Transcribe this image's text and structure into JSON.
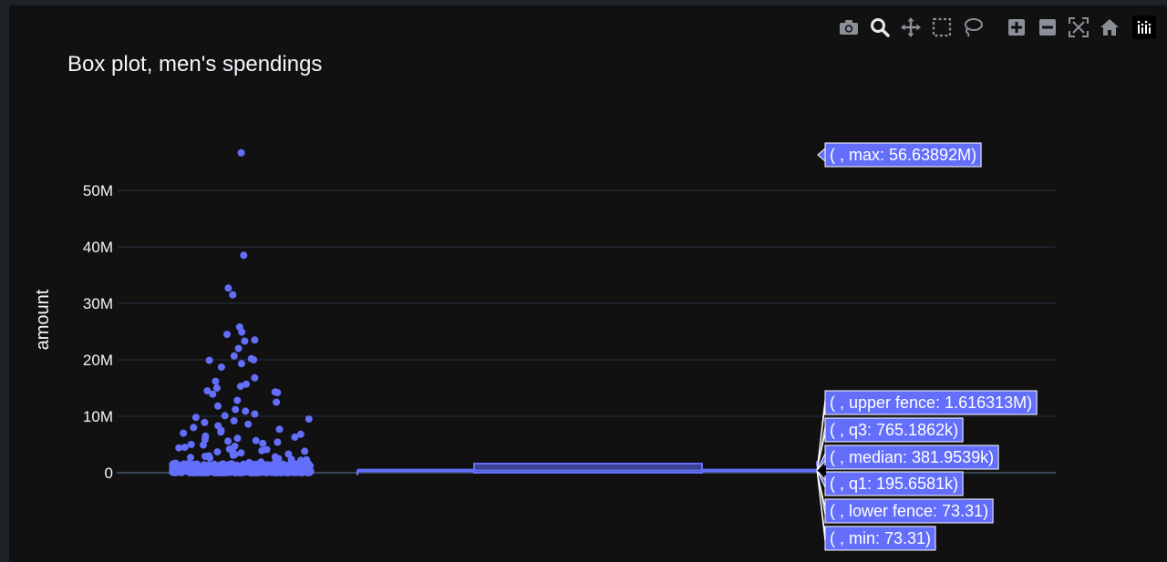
{
  "modebar": {
    "buttons": [
      {
        "name": "camera-icon",
        "title": "Download plot as a png"
      },
      {
        "name": "zoom-icon",
        "title": "Zoom"
      },
      {
        "name": "pan-icon",
        "title": "Pan"
      },
      {
        "name": "box-select-icon",
        "title": "Box Select"
      },
      {
        "name": "lasso-select-icon",
        "title": "Lasso Select"
      },
      {
        "name": "zoom-in-icon",
        "title": "Zoom in"
      },
      {
        "name": "zoom-out-icon",
        "title": "Zoom out"
      },
      {
        "name": "autoscale-icon",
        "title": "Autoscale"
      },
      {
        "name": "reset-axes-icon",
        "title": "Reset axes"
      },
      {
        "name": "plotly-logo-icon",
        "title": "Produced with Plotly"
      }
    ]
  },
  "colors": {
    "background": "#111111",
    "trace": "#636efa",
    "grid": "#283442",
    "text": "#f2f5fa"
  },
  "chart_data": {
    "type": "box",
    "title": "Box plot, men's spendings",
    "ylabel": "amount",
    "ylim": [
      -6000000,
      60000000
    ],
    "y_ticks": [
      {
        "value": 0,
        "label": "0"
      },
      {
        "value": 10000000,
        "label": "10M"
      },
      {
        "value": 20000000,
        "label": "20M"
      },
      {
        "value": 30000000,
        "label": "30M"
      },
      {
        "value": 40000000,
        "label": "40M"
      },
      {
        "value": 50000000,
        "label": "50M"
      }
    ],
    "grid": true,
    "boxpoints": "all",
    "stats": {
      "max": 56638920,
      "upper_fence": 1616313,
      "q3": 765186.2,
      "median": 381953.9,
      "q1": 195658.1,
      "lower_fence": 73.31,
      "min": 73.31
    },
    "hover_labels": [
      {
        "key": "max",
        "text": "( , max: 56.63892M)"
      },
      {
        "key": "upper_fence",
        "text": "( , upper fence: 1.616313M)"
      },
      {
        "key": "q3",
        "text": "( , q3: 765.1862k)"
      },
      {
        "key": "median",
        "text": "( , median: 381.9539k)"
      },
      {
        "key": "q1",
        "text": "( , q1: 195.6581k)"
      },
      {
        "key": "lower_fence",
        "text": "( , lower fence: 73.31)"
      },
      {
        "key": "min",
        "text": "( , min: 73.31)"
      }
    ],
    "outliers": [
      56638920,
      38500000,
      32700000,
      31500000,
      25800000,
      24900000,
      24500000,
      23500000,
      23300000,
      22000000,
      20700000,
      20200000,
      20000000,
      19900000,
      19300000,
      18700000,
      16800000,
      16200000,
      15700000,
      15300000,
      15000000,
      14500000,
      14300000,
      14200000,
      13900000,
      12800000,
      12500000,
      11800000,
      11200000,
      10900000,
      10400000,
      10100000,
      9800000,
      9500000,
      9200000,
      8900000,
      8600000,
      8300000,
      8000000,
      7700000,
      7500000,
      7200000,
      7000000,
      6800000,
      6500000,
      6300000,
      6100000,
      5900000,
      5700000,
      5600000,
      5400000,
      5200000,
      5000000,
      4900000,
      4700000,
      4500000,
      4400000,
      4200000,
      4100000,
      3900000,
      3800000,
      3700000,
      3600000,
      3500000,
      3400000,
      3300000,
      3200000,
      3100000,
      3000000,
      2900000,
      2800000,
      2700000,
      2600000,
      2500000,
      2400000,
      2300000,
      2200000,
      2100000,
      2000000,
      1900000,
      1800000,
      1700000
    ]
  }
}
